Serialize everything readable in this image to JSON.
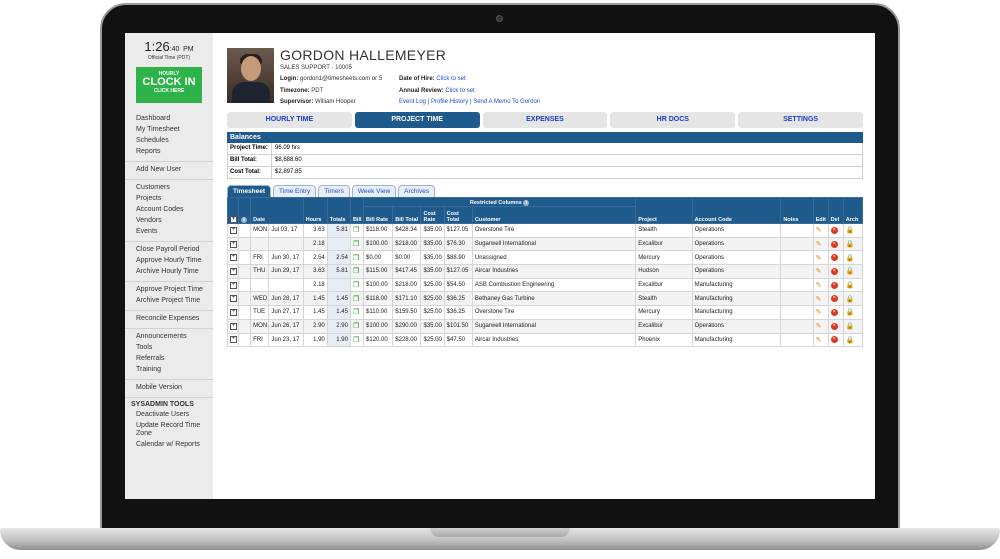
{
  "clock": {
    "time": "1:26",
    "seconds": ":40",
    "ampm": "PM",
    "subtitle": "Official Time (PDT)",
    "button_line1": "HOURLY",
    "button_line2": "CLOCK IN",
    "button_line3": "CLICK HERE"
  },
  "nav": {
    "group1": [
      "Dashboard",
      "My Timesheet",
      "Schedules",
      "Reports"
    ],
    "group2": [
      "Add New User"
    ],
    "group3": [
      "Customers",
      "Projects",
      "Account Codes",
      "Vendors",
      "Events"
    ],
    "group4": [
      "Close Payroll Period",
      "Approve Hourly Time",
      "Archive Hourly Time"
    ],
    "group5": [
      "Approve Project Time",
      "Archive Project Time"
    ],
    "group6": [
      "Reconcile Expenses"
    ],
    "group7": [
      "Announcements",
      "Tools",
      "Referrals",
      "Training"
    ],
    "group8": [
      "Mobile Version"
    ],
    "sysadmin_title": "SYSADMIN TOOLS",
    "sysadmin": [
      "Deactivate Users",
      "Update Record Time Zone",
      "Calendar w/ Reports"
    ]
  },
  "profile": {
    "name": "GORDON HALLEMEYER",
    "role": "SALES SUPPORT · 10005",
    "login_label": "Login:",
    "login_value": "gordon1@timesheets.com",
    "login_or": "or",
    "login_alt": "5",
    "timezone_label": "Timezone:",
    "timezone_value": "PDT",
    "supervisor_label": "Supervisor:",
    "supervisor_value": "William Hooper",
    "hire_label": "Date of Hire:",
    "hire_link": "Click to set",
    "review_label": "Annual Review:",
    "review_link": "Click to set",
    "links": [
      "Event Log",
      "Profile History",
      "Send A Memo To Gordon"
    ]
  },
  "tabs": [
    "HOURLY TIME",
    "PROJECT TIME",
    "EXPENSES",
    "HR DOCS",
    "SETTINGS"
  ],
  "active_tab": "PROJECT TIME",
  "balances": {
    "title": "Balances",
    "rows": [
      {
        "label": "Project Time:",
        "value": "96.09 hrs"
      },
      {
        "label": "Bill Total:",
        "value": "$8,688.60"
      },
      {
        "label": "Cost Total:",
        "value": "$2,897.85"
      }
    ]
  },
  "subtabs": [
    "Timesheet",
    "Time Entry",
    "Timers",
    "Week View",
    "Archives"
  ],
  "table": {
    "restricted_label": "Restricted Columns",
    "headers": [
      "Date",
      "Hours",
      "Totals",
      "Bill",
      "Bill Rate",
      "Bill Total",
      "Cost Rate",
      "Cost Total",
      "Customer",
      "Project",
      "Account Code",
      "Notes",
      "Edit",
      "Del",
      "Arch"
    ],
    "rows": [
      {
        "day": "MON",
        "date": "Jul 03, 17",
        "hours": "3.63",
        "total": "5.81",
        "bill_rate": "$118.00",
        "bill_total": "$428.34",
        "cost_rate": "$35.00",
        "cost_total": "$127.05",
        "customer": "Overstone Tire",
        "project": "Stealth",
        "account": "Operations"
      },
      {
        "day": "",
        "date": "",
        "hours": "2.18",
        "total": "",
        "bill_rate": "$100.00",
        "bill_total": "$218.00",
        "cost_rate": "$35.00",
        "cost_total": "$76.30",
        "customer": "Sugarwell International",
        "project": "Excalibur",
        "account": "Operations"
      },
      {
        "day": "FRI",
        "date": "Jun 30, 17",
        "hours": "2.54",
        "total": "2.54",
        "bill_rate": "$0.00",
        "bill_total": "$0.00",
        "cost_rate": "$35.00",
        "cost_total": "$88.90",
        "customer": "Unassigned",
        "project": "Mercury",
        "account": "Operations"
      },
      {
        "day": "THU",
        "date": "Jun 29, 17",
        "hours": "3.63",
        "total": "5.81",
        "bill_rate": "$115.00",
        "bill_total": "$417.45",
        "cost_rate": "$35.00",
        "cost_total": "$127.05",
        "customer": "Aircar Industries",
        "project": "Hudson",
        "account": "Operations"
      },
      {
        "day": "",
        "date": "",
        "hours": "2.18",
        "total": "",
        "bill_rate": "$100.00",
        "bill_total": "$218.00",
        "cost_rate": "$25.00",
        "cost_total": "$54.50",
        "customer": "ASB Combustion Engineering",
        "project": "Excalibur",
        "account": "Manufacturing"
      },
      {
        "day": "WED",
        "date": "Jun 28, 17",
        "hours": "1.45",
        "total": "1.45",
        "bill_rate": "$118.00",
        "bill_total": "$171.10",
        "cost_rate": "$25.00",
        "cost_total": "$36.25",
        "customer": "Bethaney Gas Turbine",
        "project": "Stealth",
        "account": "Manufacturing"
      },
      {
        "day": "TUE",
        "date": "Jun 27, 17",
        "hours": "1.45",
        "total": "1.45",
        "bill_rate": "$110.00",
        "bill_total": "$159.50",
        "cost_rate": "$25.00",
        "cost_total": "$36.25",
        "customer": "Overstone Tire",
        "project": "Mercury",
        "account": "Manufacturing"
      },
      {
        "day": "MON",
        "date": "Jun 26, 17",
        "hours": "2.90",
        "total": "2.90",
        "bill_rate": "$100.00",
        "bill_total": "$290.00",
        "cost_rate": "$35.00",
        "cost_total": "$101.50",
        "customer": "Sugarwell International",
        "project": "Excalibur",
        "account": "Operations"
      },
      {
        "day": "FRI",
        "date": "Jun 23, 17",
        "hours": "1.90",
        "total": "1.90",
        "bill_rate": "$120.00",
        "bill_total": "$228.00",
        "cost_rate": "$25.00",
        "cost_total": "$47.50",
        "customer": "Aircar Industries",
        "project": "Phoenix",
        "account": "Manufacturing"
      }
    ]
  },
  "icons": {
    "expand": "+",
    "info": "i",
    "bill": "❐",
    "edit": "✎",
    "delete": "×",
    "archive": "🔒"
  }
}
